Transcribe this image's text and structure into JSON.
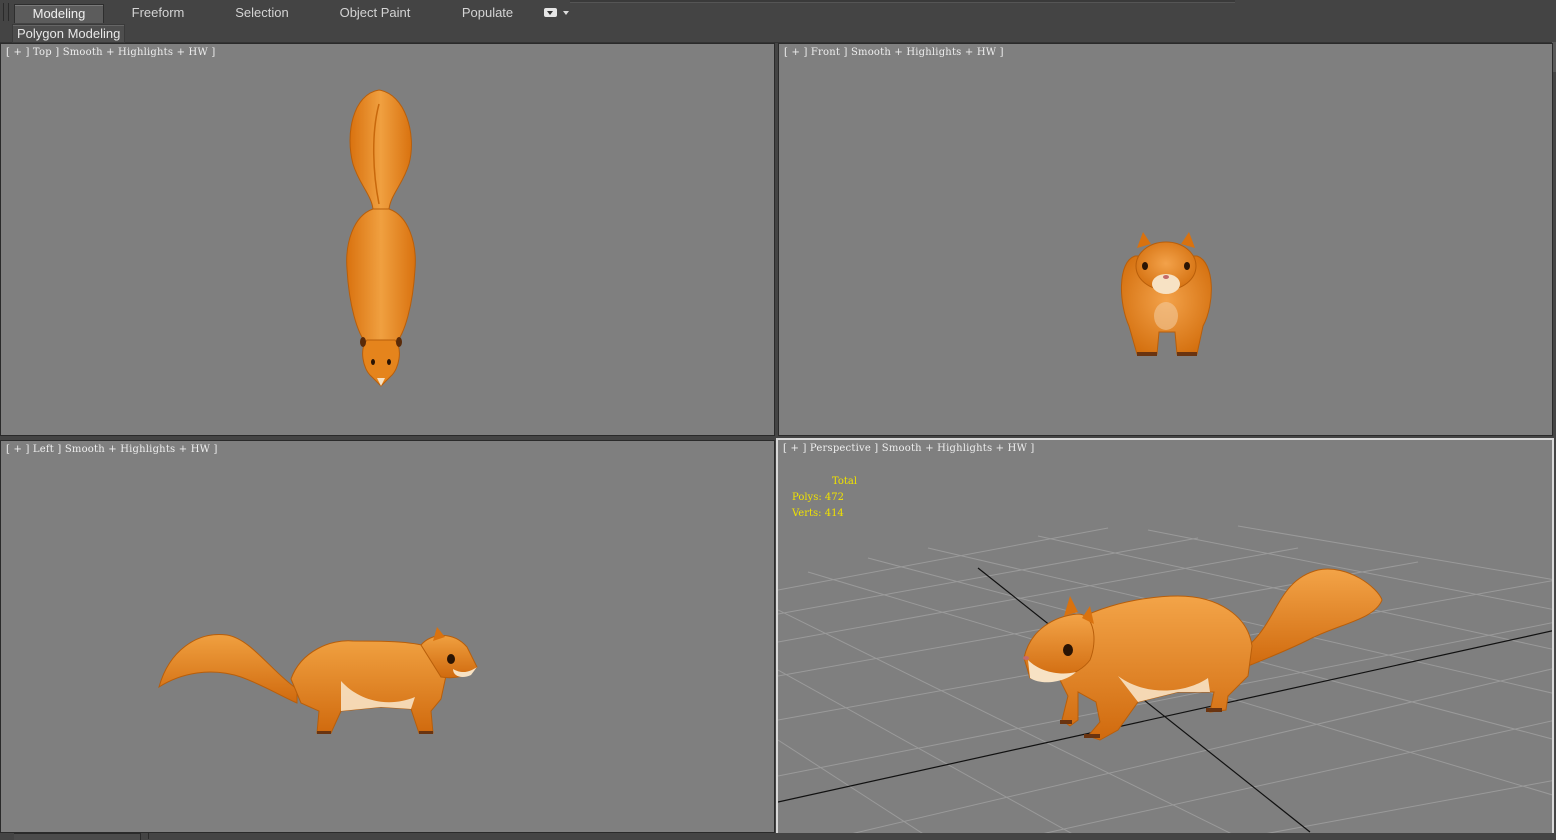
{
  "ribbon": {
    "tabs": [
      {
        "label": "Modeling",
        "active": true
      },
      {
        "label": "Freeform",
        "active": false
      },
      {
        "label": "Selection",
        "active": false
      },
      {
        "label": "Object Paint",
        "active": false
      },
      {
        "label": "Populate",
        "active": false
      }
    ],
    "panel_label": "Polygon Modeling"
  },
  "viewports": {
    "top": {
      "label": "[ + ] Top ] Smooth + Highlights + HW ]"
    },
    "front": {
      "label": "[ + ] Front ] Smooth + Highlights + HW ]"
    },
    "left": {
      "label": "[ + ] Left ] Smooth + Highlights + HW ]"
    },
    "perspective": {
      "label": "[ + ] Perspective ] Smooth + Highlights + HW ]"
    }
  },
  "stats": {
    "title": "Total",
    "polys": "Polys: 472",
    "verts": "Verts: 414"
  },
  "colors": {
    "viewport_bg": "#7f7f7f",
    "ui_bg": "#444444",
    "stats_text": "#f0e200",
    "fur": "#e88a1c",
    "fur_dark": "#c8640c",
    "belly": "#f7e2c4"
  },
  "icons": {
    "tab_menu": "dropdown-icon"
  }
}
